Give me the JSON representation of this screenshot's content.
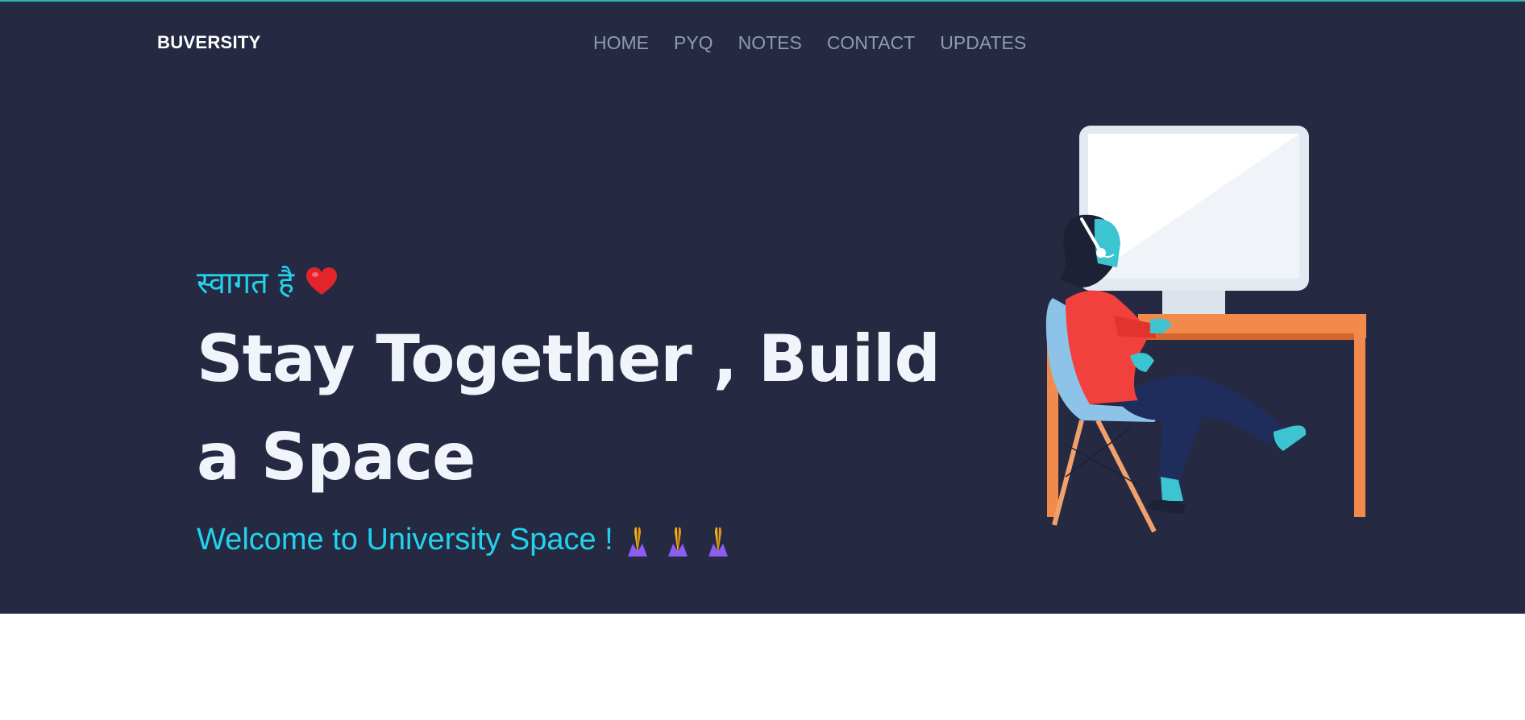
{
  "header": {
    "brand": "BUVERSITY",
    "nav": [
      {
        "label": "HOME"
      },
      {
        "label": "PYQ"
      },
      {
        "label": "NOTES"
      },
      {
        "label": "CONTACT"
      },
      {
        "label": "UPDATES"
      }
    ]
  },
  "hero": {
    "greeting": "स्वागत है",
    "headline_line1": "Stay Together , Build",
    "headline_line2": "a Space",
    "subtitle": "Welcome to University Space !"
  },
  "icons": {
    "heart": "heart-icon",
    "pray": "folded-hands-icon",
    "illustration": "person-at-computer-illustration"
  },
  "colors": {
    "hero_background": "#252a42",
    "accent_cyan": "#22d3ee",
    "headline": "#f1f5fb",
    "nav_text": "#8e9ab3",
    "desk_orange": "#f28a4b",
    "sweater_red": "#f2403c"
  }
}
